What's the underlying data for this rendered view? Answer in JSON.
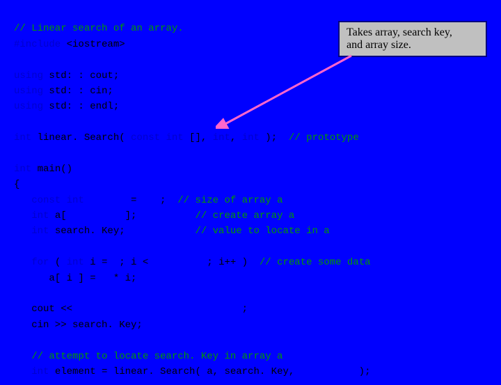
{
  "callout": {
    "line1": "Takes array, search key,",
    "line2": "and array size."
  },
  "code": {
    "c1": "// Linear search of an array.",
    "inc_pre": "#include ",
    "inc_lib": "<iostream>",
    "u1a": "using ",
    "u1b": "std: : cout;",
    "u2a": "using ",
    "u2b": "std: : cin;",
    "u3a": "using ",
    "u3b": "std: : endl;",
    "proto_a": "int ",
    "proto_b": "linear. Search( ",
    "proto_c": "const int ",
    "proto_d": "[], ",
    "proto_e": "int",
    "proto_f": ", ",
    "proto_g": "int ",
    "proto_h": ");  ",
    "proto_i": "// prototype",
    "main_a": "int ",
    "main_b": "main()",
    "brace_open": "{",
    "m1_a": "   const int        ",
    "m1_b": "=    ;  ",
    "m1_c": "// size of array a",
    "m2_a": "   int ",
    "m2_b": "a[          ];          ",
    "m2_c": "// create array a",
    "m3_a": "   int ",
    "m3_b": "search. Key;            ",
    "m3_c": "// value to locate in a",
    "for_a": "   for ",
    "for_b": "( ",
    "for_c": "int ",
    "for_d": "i =  ; i <          ; i++ )  ",
    "for_e": "// create some data",
    "for_body": "      a[ i ] =   * i;",
    "cout_line": "   cout <<                             ;",
    "cin_line": "   cin >> search. Key;",
    "cmt_attempt": "   // attempt to locate search. Key in array a",
    "last_a": "   int ",
    "last_b": "element = linear. Search( a, search. Key,           );"
  }
}
